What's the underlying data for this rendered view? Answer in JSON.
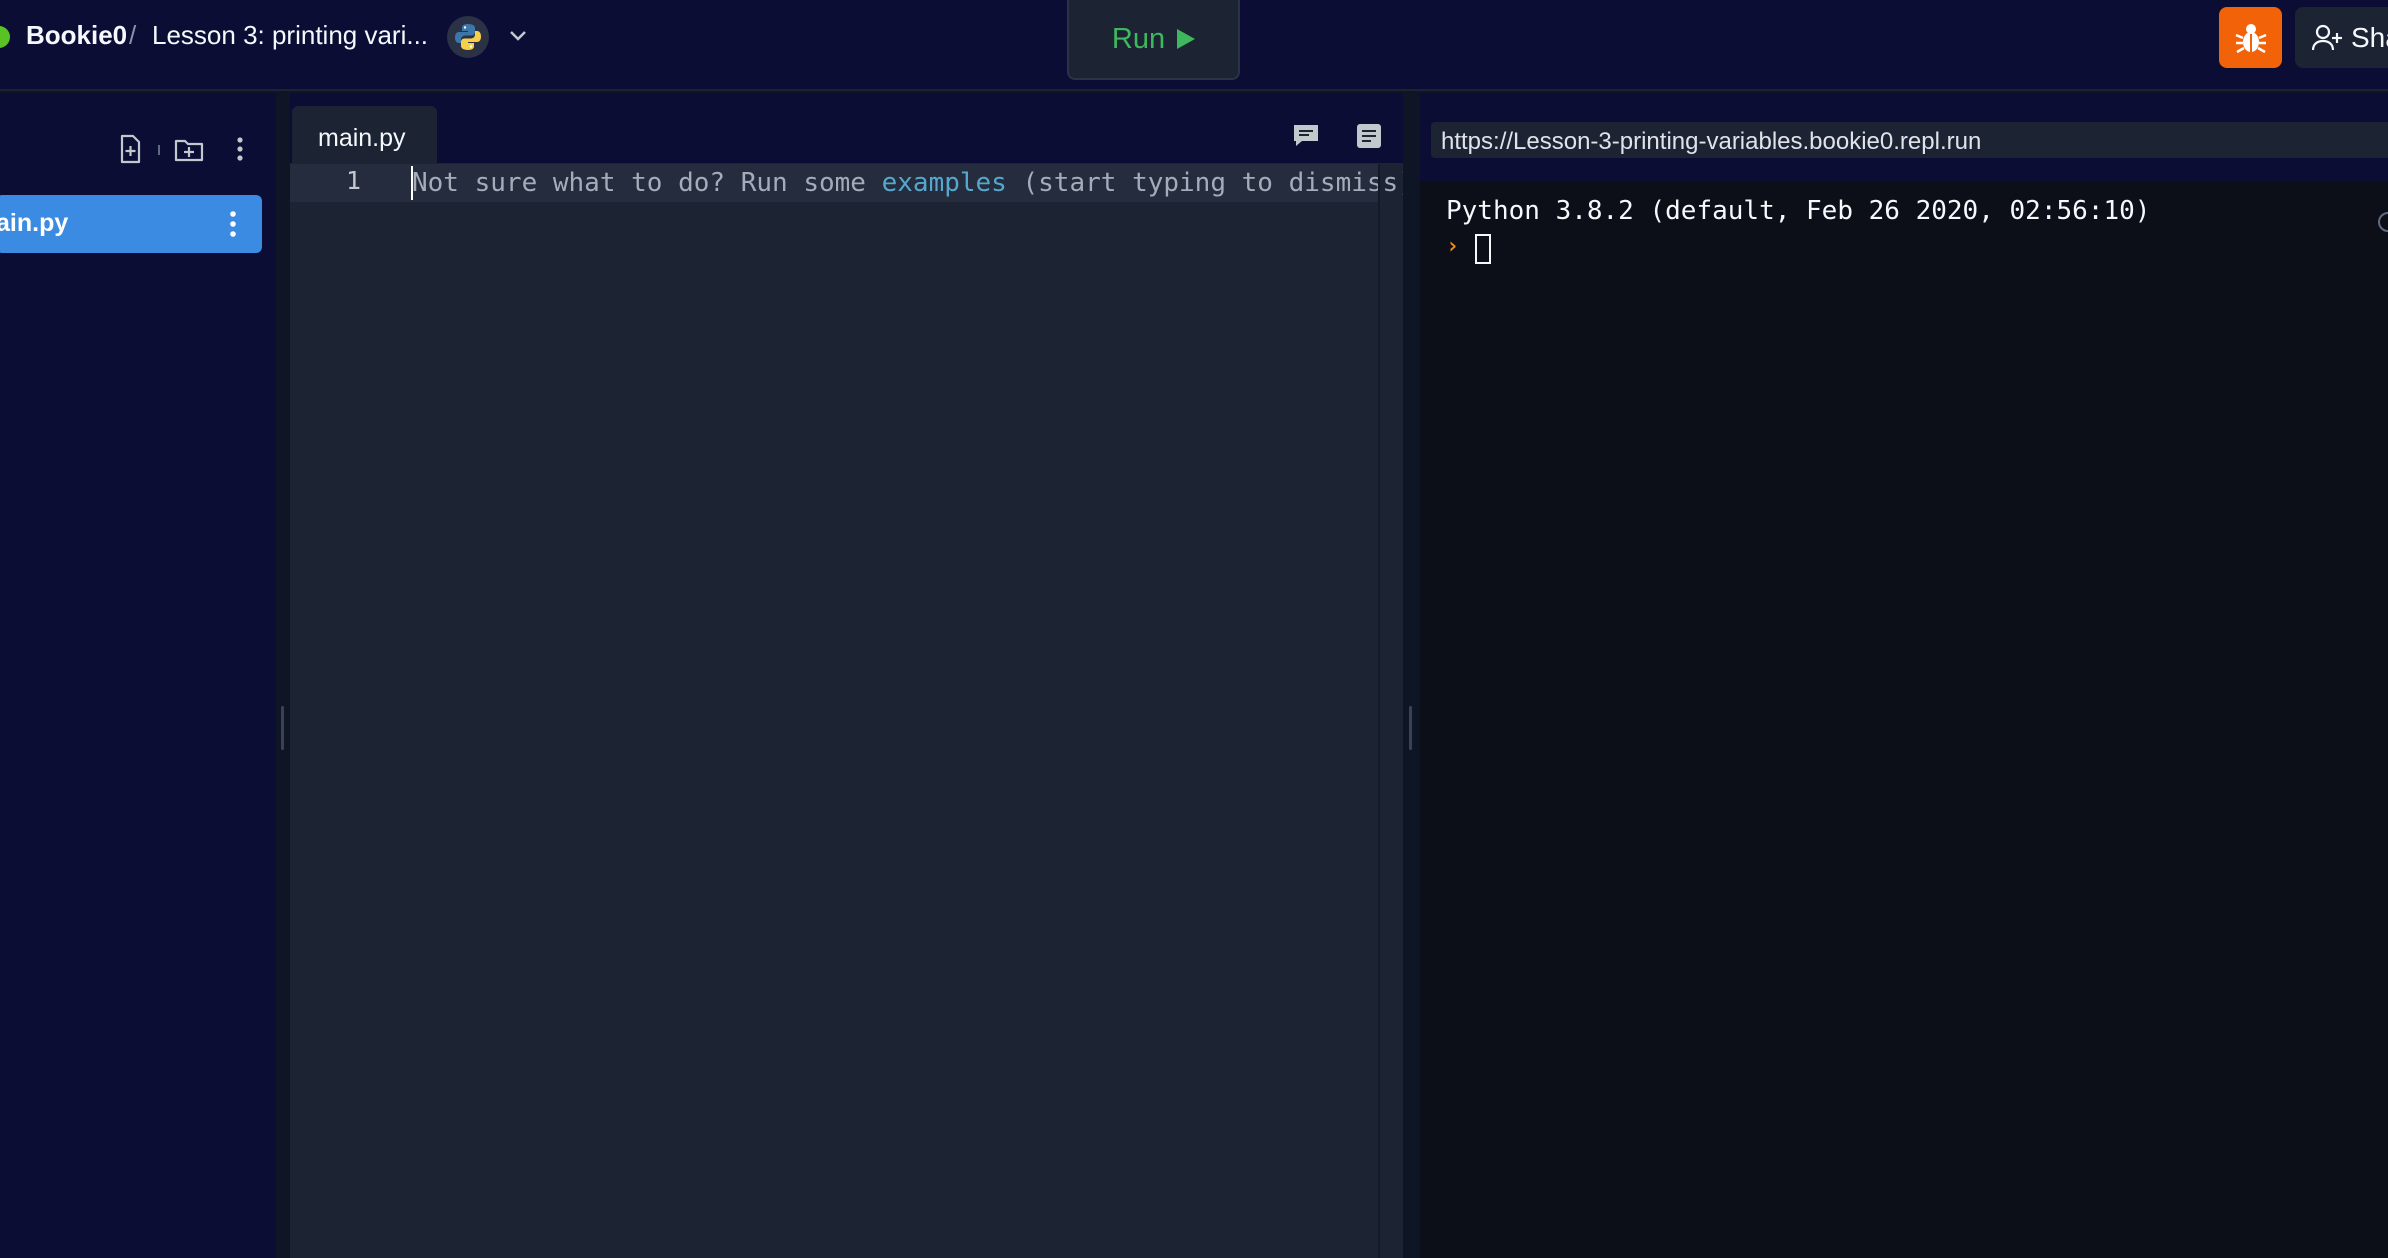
{
  "header": {
    "user": "Bookie0",
    "separator": "/",
    "repl_title": "Lesson 3: printing vari...",
    "language_icon": "python-logo-icon",
    "run_label": "Run",
    "share_label": "Sha"
  },
  "sidebar": {
    "files": [
      {
        "name": "ain.py",
        "selected": true
      }
    ]
  },
  "editor": {
    "tab_label": "main.py",
    "line_number": "1",
    "placeholder_prefix": "Not sure what to do? Run some ",
    "placeholder_link": "examples",
    "placeholder_suffix": " (start typing to dismiss)"
  },
  "console": {
    "url": "https://Lesson-3-printing-variables.bookie0.repl.run",
    "banner": "Python 3.8.2 (default, Feb 26 2020, 02:56:10)",
    "prompt": "›"
  },
  "colors": {
    "run_green": "#3db85c",
    "debug_orange": "#f26208",
    "selected_file_blue": "#3c8be3",
    "prompt_orange": "#ff8a00",
    "link_blue": "#55a7ce"
  }
}
